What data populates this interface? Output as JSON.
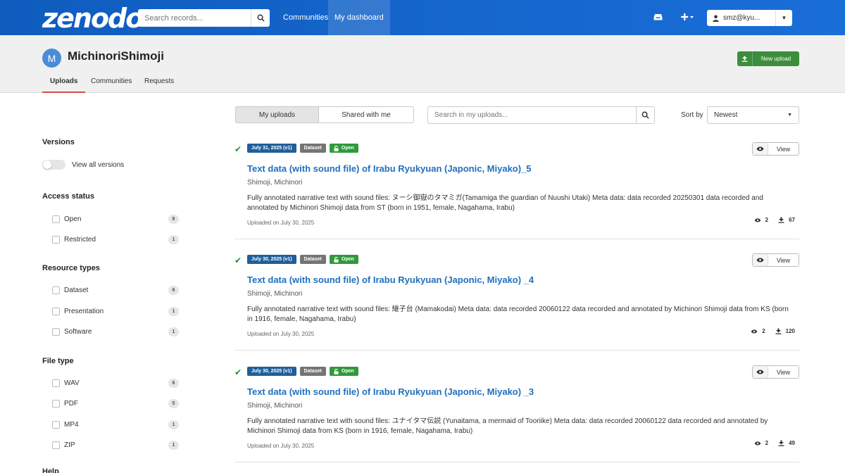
{
  "navbar": {
    "logo": "zenodo",
    "search_placeholder": "Search records...",
    "links": [
      "Communities",
      "My dashboard"
    ],
    "user": "smz@kyu..."
  },
  "header": {
    "avatar_letter": "M",
    "title": "MichinoriShimoji",
    "new_upload": "New upload",
    "tabs": [
      "Uploads",
      "Communities",
      "Requests"
    ]
  },
  "sidebar": {
    "versions": {
      "heading": "Versions",
      "toggle_label": "View all versions"
    },
    "access": {
      "heading": "Access status",
      "items": [
        {
          "label": "Open",
          "count": "8"
        },
        {
          "label": "Restricted",
          "count": "1"
        }
      ]
    },
    "resource": {
      "heading": "Resource types",
      "items": [
        {
          "label": "Dataset",
          "count": "6"
        },
        {
          "label": "Presentation",
          "count": "1"
        },
        {
          "label": "Software",
          "count": "1"
        }
      ]
    },
    "filetype": {
      "heading": "File type",
      "items": [
        {
          "label": "WAV",
          "count": "6"
        },
        {
          "label": "PDF",
          "count": "5"
        },
        {
          "label": "MP4",
          "count": "1"
        },
        {
          "label": "ZIP",
          "count": "1"
        }
      ]
    },
    "help": {
      "heading": "Help"
    }
  },
  "main": {
    "seg": [
      "My uploads",
      "Shared with me"
    ],
    "search_placeholder": "Search in my uploads...",
    "sort_label": "Sort by",
    "sort_value": "Newest",
    "view_label": "View",
    "records": [
      {
        "date": "July 31, 2025 (v1)",
        "type": "Dataset",
        "access": "Open",
        "title": "Text data (with sound file) of Irabu Ryukyuan (Japonic, Miyako)_5",
        "creators": "Shimoji, Michinori",
        "description": "Fully annotated narrative text with sound files: ヌーシ御嶽のタマミガ(Tamamiga the guardian of Nuushi Utaki) Meta data: data recorded 20250301 data recorded and annotated by Michinori Shimoji data from ST (born in 1951, female, Nagahama, Irabu)",
        "uploaded": "Uploaded on July 30, 2025",
        "views": "2",
        "downloads": "67"
      },
      {
        "date": "July 30, 2025 (v1)",
        "type": "Dataset",
        "access": "Open",
        "title": "Text data (with sound file) of Irabu Ryukyuan (Japonic, Miyako) _4",
        "creators": "Shimoji, Michinori",
        "description": "Fully annotated narrative text with sound files: 継子台 (Mamakodai) Meta data: data recorded 20060122 data recorded and annotated by Michinori Shimoji data from KS (born in 1916, female, Nagahama, Irabu)",
        "uploaded": "Uploaded on July 30, 2025",
        "views": "2",
        "downloads": "120"
      },
      {
        "date": "July 30, 2025 (v1)",
        "type": "Dataset",
        "access": "Open",
        "title": "Text data (with sound file) of Irabu Ryukyuan (Japonic, Miyako) _3",
        "creators": "Shimoji, Michinori",
        "description": "Fully annotated narrative text with sound files: ユナイタマ伝説 (Yunaitama, a mermaid of Tooriike) Meta data: data recorded 20060122 data recorded and annotated by Michinori Shimoji data from KS (born in 1916, female, Nagahama, Irabu)",
        "uploaded": "Uploaded on July 30, 2025",
        "views": "2",
        "downloads": "49"
      }
    ]
  },
  "colors": {
    "navbar": "#1a6ed8",
    "title_link": "#1f6fc0",
    "date_badge": "#1f5f9a",
    "open_badge": "#2f9a3c",
    "new_upload": "#3c8e3c",
    "tab_underline": "#d64b4b"
  }
}
